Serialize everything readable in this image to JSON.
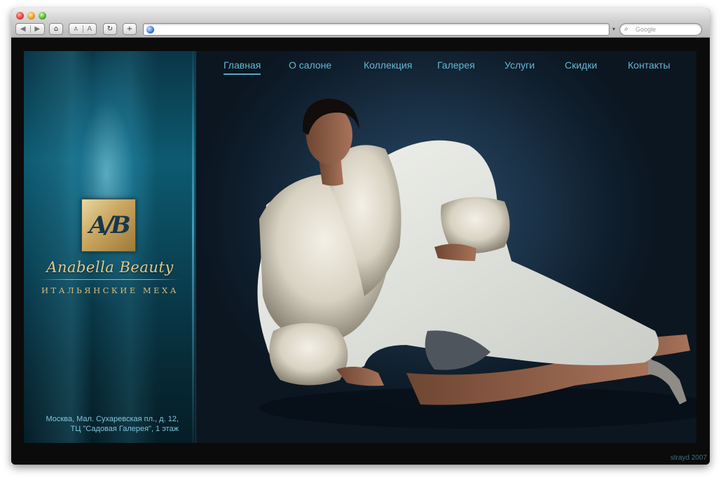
{
  "browser": {
    "search_placeholder": "Google",
    "reader_label": "A",
    "url": ""
  },
  "site": {
    "brand": {
      "monogram": "A/B",
      "name": "Anabella Beauty",
      "tagline": "ИТАЛЬЯНСКИЕ МЕХА"
    },
    "nav": {
      "items": [
        {
          "label": "Главная",
          "active": true
        },
        {
          "label": "О салоне",
          "active": false
        },
        {
          "label": "Коллекция",
          "active": false
        },
        {
          "label": "Галерея",
          "active": false
        },
        {
          "label": "Услуги",
          "active": false
        },
        {
          "label": "Скидки",
          "active": false
        },
        {
          "label": "Контакты",
          "active": false
        }
      ]
    },
    "address": {
      "line1": "Москва, Мал. Сухаревская пл., д. 12,",
      "line2": "ТЦ \"Садовая Галерея\", 1 этаж"
    },
    "credit": "strayd 2007"
  },
  "colors": {
    "accent": "#65b8d3",
    "gold": "#c9a560",
    "background": "#0b1621"
  },
  "icons": [
    "back-icon",
    "forward-icon",
    "home-icon",
    "reload-icon",
    "add-icon",
    "globe-icon",
    "search-icon"
  ]
}
